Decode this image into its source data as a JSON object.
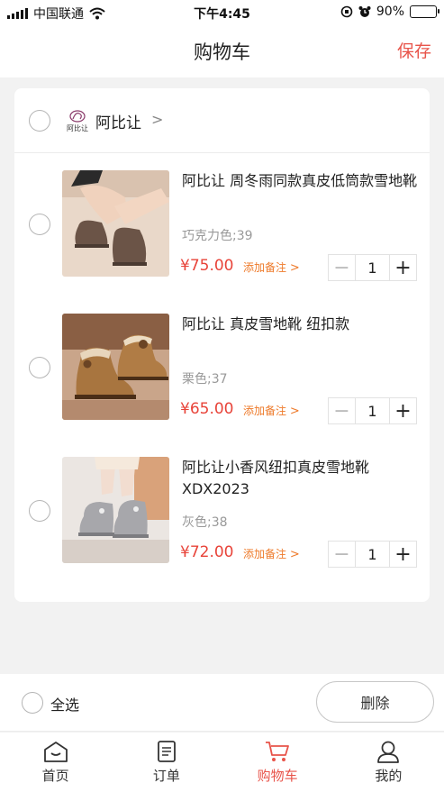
{
  "status_bar": {
    "carrier": "中国联通",
    "time": "下午4:45",
    "battery": "90%",
    "battery_level": 0.9
  },
  "nav": {
    "title": "购物车",
    "save_label": "保存"
  },
  "shop": {
    "name": "阿比让",
    "logo_text": "阿比让"
  },
  "items": [
    {
      "title": "阿比让 周冬雨同款真皮低筒款雪地靴",
      "spec": "巧克力色;39",
      "price": "¥75.00",
      "remark": "添加备注",
      "quantity": "1"
    },
    {
      "title": "阿比让 真皮雪地靴 纽扣款",
      "spec": "栗色;37",
      "price": "¥65.00",
      "remark": "添加备注",
      "quantity": "1"
    },
    {
      "title": "阿比让小香风纽扣真皮雪地靴 XDX2023",
      "spec": "灰色;38",
      "price": "¥72.00",
      "remark": "添加备注",
      "quantity": "1"
    }
  ],
  "footer": {
    "select_all": "全选",
    "delete": "删除"
  },
  "tabs": [
    {
      "label": "首页",
      "icon": "home-icon"
    },
    {
      "label": "订单",
      "icon": "order-icon"
    },
    {
      "label": "购物车",
      "icon": "cart-icon",
      "active": true
    },
    {
      "label": "我的",
      "icon": "user-icon"
    }
  ],
  "colors": {
    "accent": "#e8544a",
    "price": "#e8443a",
    "remark": "#ee7a2a"
  }
}
